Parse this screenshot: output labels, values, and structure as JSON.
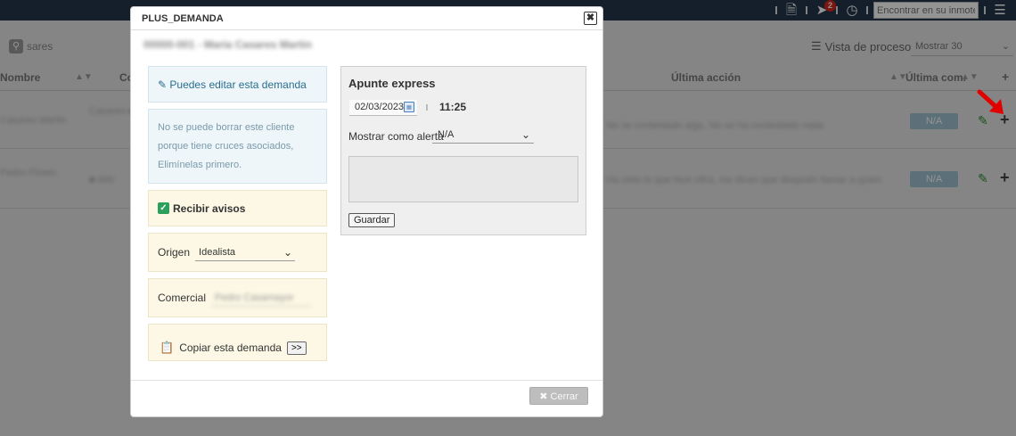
{
  "topbar": {
    "search_placeholder": "Encontrar en su inmotek",
    "notification_count": "2",
    "icons": [
      "document-icon",
      "paper-plane-icon",
      "clock-icon",
      "menu-icon"
    ]
  },
  "filters": {
    "search_value": "sares",
    "process_view_label": "Vista de proceso",
    "show_count_label": "Mostrar 30"
  },
  "table": {
    "headers": {
      "nombre": "Nombre",
      "ultima_accion": "Última acción",
      "ultima_com": "Última com."
    },
    "rows": [
      {
        "status": "N/A"
      },
      {
        "status": "N/A"
      }
    ]
  },
  "modal": {
    "title": "PLUS_DEMANDA",
    "client_name": "00000-001 - Maria Casares Martin",
    "edit_notice": "Puedes editar esta demanda",
    "delete_notice": "No se puede borrar este cliente porque tiene cruces asociados, Elimínelas primero.",
    "avisos_label": "Recibir avisos",
    "origen_label": "Origen",
    "origen_value": "Idealista",
    "comercial_label": "Comercial",
    "comercial_value": "Pedro Casamayor",
    "copy_label": "Copiar esta demanda",
    "copy_button": ">>",
    "apunte": {
      "title": "Apunte express",
      "date": "02/03/2023",
      "time": "11:25",
      "alert_label": "Mostrar como alerta",
      "alert_value": "N/A",
      "save_button": "Guardar"
    },
    "close_button": "Cerrar"
  },
  "colors": {
    "topbar_bg": "#24364a",
    "info_box_bg": "#eef6fa",
    "yellow_box_bg": "#fcf8e5",
    "checkbox": "#2aa05a",
    "badge_red": "#d9261c",
    "arrow_red": "#e00000"
  }
}
